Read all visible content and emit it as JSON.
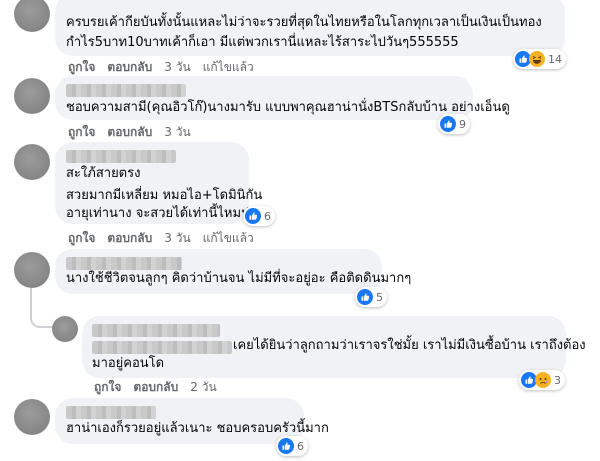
{
  "comments": [
    {
      "lines": [
        "ครบรยเค้ากียบันทั้งนั้นแหละไม่ว่าจะรวยที่สุดในไทยหรือในโลกทุกเวลาเป็นเงินเป็นทอง",
        "กำไร5บาท10บาทเค้าก็เอา มีแต่พวกเรานี่แหละไร้สาระไปวันๆ555555"
      ],
      "like": "ถูกใจ",
      "reply": "ตอบกลับ",
      "time": "3 วัน",
      "edited": "แก้ไขแล้ว",
      "reactions": [
        "like",
        "haha"
      ],
      "count": "14"
    },
    {
      "lines": [
        "ชอบความสามี(คุณอิวโก๊)นางมารับ แบบพาคุณฮาน่านั่งBTSกลับบ้าน อย่างเอ็นดู"
      ],
      "like": "ถูกใจ",
      "reply": "ตอบกลับ",
      "time": "3 วัน",
      "reactions": [
        "like"
      ],
      "count": "9"
    },
    {
      "lines": [
        "สะใภ้สายตรง",
        "สวยมากมีเหลี่ยม หมอไอ+โดมินิกัน",
        "อายุเท่านาง จะสวยได้เท่านี้ไหมน่อ"
      ],
      "like": "ถูกใจ",
      "reply": "ตอบกลับ",
      "time": "3 วัน",
      "edited": "แก้ไขแล้ว",
      "reactions": [
        "like"
      ],
      "count": "6"
    },
    {
      "lines": [
        "นางใช้ชีวิตจนลูกๆ คิดว่าบ้านจน ไม่มีที่จะอยู่อะ คือติดดินมากๆ"
      ],
      "like": "ถูกใจ",
      "reply": "ตอบกลับ",
      "time": "3 วัน",
      "reactions": [
        "like"
      ],
      "count": "5"
    },
    {
      "lines": [
        "เคยได้ยินว่าลูกถามว่าเราจรใช่มั้ย เราไม่มีเงินซื้อบ้าน เราถึงต้อง",
        "มาอยู่คอนโด"
      ],
      "like": "ถูกใจ",
      "reply": "ตอบกลับ",
      "time": "2 วัน",
      "reactions": [
        "like",
        "sad"
      ],
      "count": "3"
    },
    {
      "lines": [
        "ฮาน่าเองก็รวยอยู่แล้วเนาะ ชอบครอบครัวนี้มาก"
      ],
      "like": "ถูกใจ",
      "reply": "ตอบกลับ",
      "time": "3 วัน",
      "reactions": [
        "like"
      ],
      "count": "6"
    }
  ]
}
